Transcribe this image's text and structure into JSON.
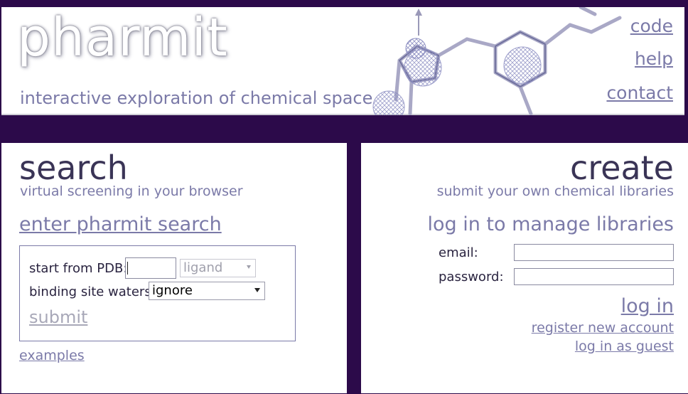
{
  "header": {
    "logo_text": "pharmit",
    "tagline": "interactive exploration of chemical space",
    "links": {
      "code": "code",
      "help": "help",
      "contact": "contact"
    }
  },
  "search": {
    "title": "search",
    "subtitle": "virtual screening in your browser",
    "enter_link": "enter pharmit search",
    "pdb_label": "start from PDB:",
    "pdb_value": "",
    "ligand_select": "ligand",
    "waters_label": "binding site waters:",
    "waters_select": "ignore",
    "submit": "submit",
    "examples": "examples"
  },
  "create": {
    "title": "create",
    "subtitle": "submit your own chemical libraries",
    "login_heading": "log in to manage libraries",
    "email_label": "email:",
    "password_label": "password:",
    "login_link": "log in",
    "register_link": "register new account",
    "guest_link": "log in as guest"
  },
  "colors": {
    "background": "#2c0a4a",
    "accent": "#7b7aa8",
    "title": "#3a3456"
  }
}
